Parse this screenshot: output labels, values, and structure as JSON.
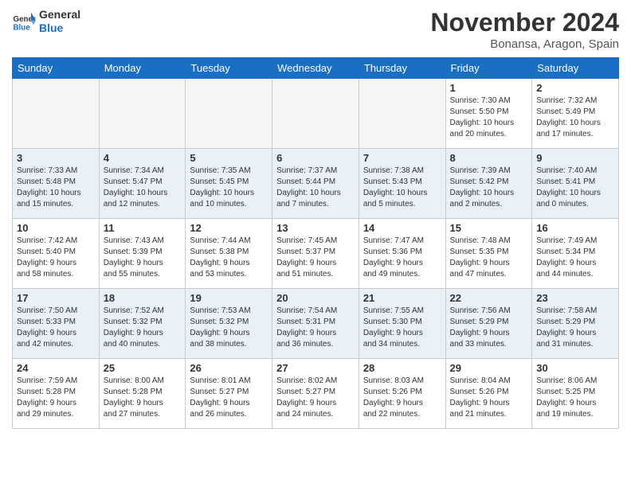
{
  "header": {
    "logo_line1": "General",
    "logo_line2": "Blue",
    "month": "November 2024",
    "location": "Bonansa, Aragon, Spain"
  },
  "weekdays": [
    "Sunday",
    "Monday",
    "Tuesday",
    "Wednesday",
    "Thursday",
    "Friday",
    "Saturday"
  ],
  "weeks": [
    [
      {
        "day": "",
        "info": ""
      },
      {
        "day": "",
        "info": ""
      },
      {
        "day": "",
        "info": ""
      },
      {
        "day": "",
        "info": ""
      },
      {
        "day": "",
        "info": ""
      },
      {
        "day": "1",
        "info": "Sunrise: 7:30 AM\nSunset: 5:50 PM\nDaylight: 10 hours\nand 20 minutes."
      },
      {
        "day": "2",
        "info": "Sunrise: 7:32 AM\nSunset: 5:49 PM\nDaylight: 10 hours\nand 17 minutes."
      }
    ],
    [
      {
        "day": "3",
        "info": "Sunrise: 7:33 AM\nSunset: 5:48 PM\nDaylight: 10 hours\nand 15 minutes."
      },
      {
        "day": "4",
        "info": "Sunrise: 7:34 AM\nSunset: 5:47 PM\nDaylight: 10 hours\nand 12 minutes."
      },
      {
        "day": "5",
        "info": "Sunrise: 7:35 AM\nSunset: 5:45 PM\nDaylight: 10 hours\nand 10 minutes."
      },
      {
        "day": "6",
        "info": "Sunrise: 7:37 AM\nSunset: 5:44 PM\nDaylight: 10 hours\nand 7 minutes."
      },
      {
        "day": "7",
        "info": "Sunrise: 7:38 AM\nSunset: 5:43 PM\nDaylight: 10 hours\nand 5 minutes."
      },
      {
        "day": "8",
        "info": "Sunrise: 7:39 AM\nSunset: 5:42 PM\nDaylight: 10 hours\nand 2 minutes."
      },
      {
        "day": "9",
        "info": "Sunrise: 7:40 AM\nSunset: 5:41 PM\nDaylight: 10 hours\nand 0 minutes."
      }
    ],
    [
      {
        "day": "10",
        "info": "Sunrise: 7:42 AM\nSunset: 5:40 PM\nDaylight: 9 hours\nand 58 minutes."
      },
      {
        "day": "11",
        "info": "Sunrise: 7:43 AM\nSunset: 5:39 PM\nDaylight: 9 hours\nand 55 minutes."
      },
      {
        "day": "12",
        "info": "Sunrise: 7:44 AM\nSunset: 5:38 PM\nDaylight: 9 hours\nand 53 minutes."
      },
      {
        "day": "13",
        "info": "Sunrise: 7:45 AM\nSunset: 5:37 PM\nDaylight: 9 hours\nand 51 minutes."
      },
      {
        "day": "14",
        "info": "Sunrise: 7:47 AM\nSunset: 5:36 PM\nDaylight: 9 hours\nand 49 minutes."
      },
      {
        "day": "15",
        "info": "Sunrise: 7:48 AM\nSunset: 5:35 PM\nDaylight: 9 hours\nand 47 minutes."
      },
      {
        "day": "16",
        "info": "Sunrise: 7:49 AM\nSunset: 5:34 PM\nDaylight: 9 hours\nand 44 minutes."
      }
    ],
    [
      {
        "day": "17",
        "info": "Sunrise: 7:50 AM\nSunset: 5:33 PM\nDaylight: 9 hours\nand 42 minutes."
      },
      {
        "day": "18",
        "info": "Sunrise: 7:52 AM\nSunset: 5:32 PM\nDaylight: 9 hours\nand 40 minutes."
      },
      {
        "day": "19",
        "info": "Sunrise: 7:53 AM\nSunset: 5:32 PM\nDaylight: 9 hours\nand 38 minutes."
      },
      {
        "day": "20",
        "info": "Sunrise: 7:54 AM\nSunset: 5:31 PM\nDaylight: 9 hours\nand 36 minutes."
      },
      {
        "day": "21",
        "info": "Sunrise: 7:55 AM\nSunset: 5:30 PM\nDaylight: 9 hours\nand 34 minutes."
      },
      {
        "day": "22",
        "info": "Sunrise: 7:56 AM\nSunset: 5:29 PM\nDaylight: 9 hours\nand 33 minutes."
      },
      {
        "day": "23",
        "info": "Sunrise: 7:58 AM\nSunset: 5:29 PM\nDaylight: 9 hours\nand 31 minutes."
      }
    ],
    [
      {
        "day": "24",
        "info": "Sunrise: 7:59 AM\nSunset: 5:28 PM\nDaylight: 9 hours\nand 29 minutes."
      },
      {
        "day": "25",
        "info": "Sunrise: 8:00 AM\nSunset: 5:28 PM\nDaylight: 9 hours\nand 27 minutes."
      },
      {
        "day": "26",
        "info": "Sunrise: 8:01 AM\nSunset: 5:27 PM\nDaylight: 9 hours\nand 26 minutes."
      },
      {
        "day": "27",
        "info": "Sunrise: 8:02 AM\nSunset: 5:27 PM\nDaylight: 9 hours\nand 24 minutes."
      },
      {
        "day": "28",
        "info": "Sunrise: 8:03 AM\nSunset: 5:26 PM\nDaylight: 9 hours\nand 22 minutes."
      },
      {
        "day": "29",
        "info": "Sunrise: 8:04 AM\nSunset: 5:26 PM\nDaylight: 9 hours\nand 21 minutes."
      },
      {
        "day": "30",
        "info": "Sunrise: 8:06 AM\nSunset: 5:25 PM\nDaylight: 9 hours\nand 19 minutes."
      }
    ]
  ],
  "alt_rows": [
    1,
    3
  ],
  "colors": {
    "header_bg": "#1a6fc4",
    "alt_row_bg": "#e8f0f8",
    "normal_bg": "#ffffff",
    "empty_bg": "#f5f5f5"
  }
}
